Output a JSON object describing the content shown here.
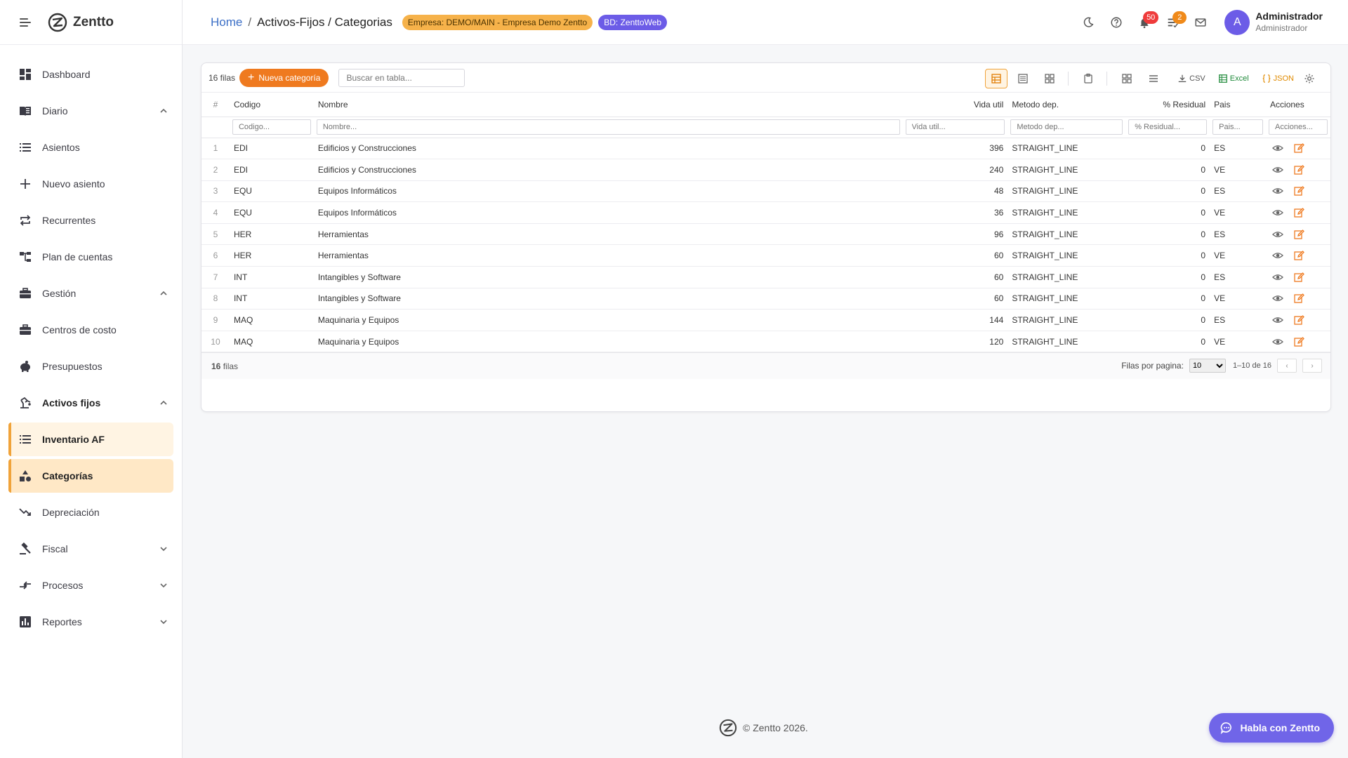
{
  "app": {
    "name": "Zentto"
  },
  "sidebar": {
    "items": [
      {
        "label": "Dashboard"
      },
      {
        "label": "Diario"
      },
      {
        "label": "Asientos"
      },
      {
        "label": "Nuevo asiento"
      },
      {
        "label": "Recurrentes"
      },
      {
        "label": "Plan de cuentas"
      },
      {
        "label": "Gestión"
      },
      {
        "label": "Centros de costo"
      },
      {
        "label": "Presupuestos"
      },
      {
        "label": "Activos fijos"
      },
      {
        "label": "Inventario AF"
      },
      {
        "label": "Categorías"
      },
      {
        "label": "Depreciación"
      },
      {
        "label": "Fiscal"
      },
      {
        "label": "Procesos"
      },
      {
        "label": "Reportes"
      }
    ]
  },
  "header": {
    "breadcrumb_home": "Home",
    "breadcrumb_sep": "/",
    "breadcrumb_current": "Activos-Fijos / Categorias",
    "company_badge": "Empresa: DEMO/MAIN - Empresa Demo Zentto",
    "db_badge": "BD: ZenttoWeb",
    "notif_count": "50",
    "tasks_count": "2",
    "avatar_letter": "A",
    "user_name": "Administrador",
    "user_role": "Administrador"
  },
  "toolbar": {
    "rows_label": "16 filas",
    "new_button": "Nueva categoría",
    "search_placeholder": "Buscar en tabla...",
    "export_csv": "CSV",
    "export_excel": "Excel",
    "export_json": "JSON"
  },
  "table": {
    "columns": [
      "#",
      "Codigo",
      "Nombre",
      "Vida util",
      "Metodo dep.",
      "% Residual",
      "Pais",
      "Acciones"
    ],
    "filters": [
      "Codigo...",
      "Nombre...",
      "Vida util...",
      "Metodo dep...",
      "% Residual...",
      "Pais...",
      "Acciones..."
    ],
    "rows": [
      {
        "idx": "1",
        "codigo": "EDI",
        "nombre": "Edificios y Construcciones",
        "vida": "396",
        "metodo": "STRAIGHT_LINE",
        "residual": "0",
        "pais": "ES"
      },
      {
        "idx": "2",
        "codigo": "EDI",
        "nombre": "Edificios y Construcciones",
        "vida": "240",
        "metodo": "STRAIGHT_LINE",
        "residual": "0",
        "pais": "VE"
      },
      {
        "idx": "3",
        "codigo": "EQU",
        "nombre": "Equipos Informáticos",
        "vida": "48",
        "metodo": "STRAIGHT_LINE",
        "residual": "0",
        "pais": "ES"
      },
      {
        "idx": "4",
        "codigo": "EQU",
        "nombre": "Equipos Informáticos",
        "vida": "36",
        "metodo": "STRAIGHT_LINE",
        "residual": "0",
        "pais": "VE"
      },
      {
        "idx": "5",
        "codigo": "HER",
        "nombre": "Herramientas",
        "vida": "96",
        "metodo": "STRAIGHT_LINE",
        "residual": "0",
        "pais": "ES"
      },
      {
        "idx": "6",
        "codigo": "HER",
        "nombre": "Herramientas",
        "vida": "60",
        "metodo": "STRAIGHT_LINE",
        "residual": "0",
        "pais": "VE"
      },
      {
        "idx": "7",
        "codigo": "INT",
        "nombre": "Intangibles y Software",
        "vida": "60",
        "metodo": "STRAIGHT_LINE",
        "residual": "0",
        "pais": "ES"
      },
      {
        "idx": "8",
        "codigo": "INT",
        "nombre": "Intangibles y Software",
        "vida": "60",
        "metodo": "STRAIGHT_LINE",
        "residual": "0",
        "pais": "VE"
      },
      {
        "idx": "9",
        "codigo": "MAQ",
        "nombre": "Maquinaria y Equipos",
        "vida": "144",
        "metodo": "STRAIGHT_LINE",
        "residual": "0",
        "pais": "ES"
      },
      {
        "idx": "10",
        "codigo": "MAQ",
        "nombre": "Maquinaria y Equipos",
        "vida": "120",
        "metodo": "STRAIGHT_LINE",
        "residual": "0",
        "pais": "VE"
      }
    ]
  },
  "footer_bar": {
    "count": "16",
    "count_suffix": "filas",
    "per_page_label": "Filas por pagina:",
    "per_page_value": "10",
    "range": "1–10 de 16",
    "prev": "‹",
    "next": "›"
  },
  "page_footer": {
    "copyright": "© Zentto 2026."
  },
  "chat": {
    "label": "Habla con Zentto"
  },
  "colors": {
    "accent": "#ef7a1f",
    "brand_purple": "#6c5ce7",
    "link": "#3c6fc6"
  }
}
